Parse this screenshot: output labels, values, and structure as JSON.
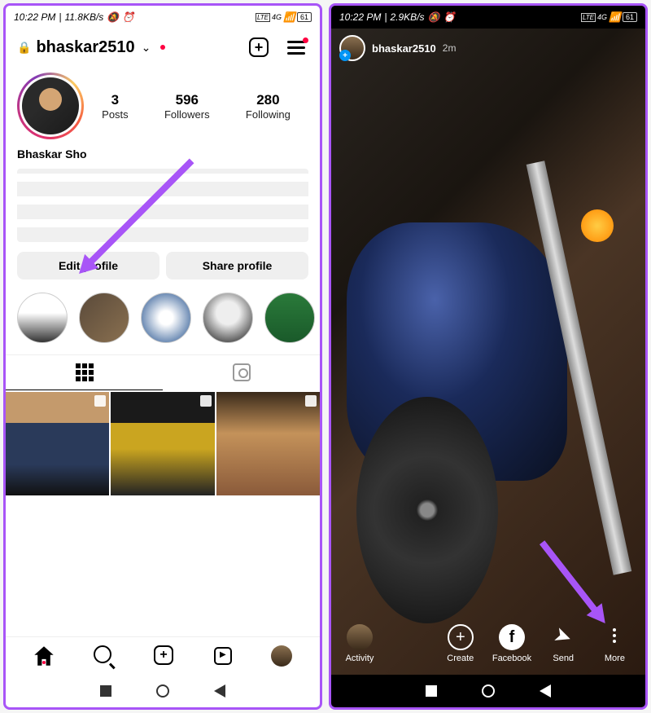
{
  "left": {
    "status": {
      "time": "10:22 PM",
      "speed": "11.8KB/s",
      "network": "4G",
      "battery": "61"
    },
    "header": {
      "username": "bhaskar2510"
    },
    "profile": {
      "stats": {
        "posts": "3",
        "posts_lbl": "Posts",
        "followers": "596",
        "followers_lbl": "Followers",
        "following": "280",
        "following_lbl": "Following"
      },
      "display_name": "Bhaskar Sho"
    },
    "buttons": {
      "edit": "Edit profile",
      "share": "Share profile"
    }
  },
  "right": {
    "status": {
      "time": "10:22 PM",
      "speed": "2.9KB/s",
      "network": "4G",
      "battery": "61"
    },
    "story": {
      "username": "bhaskar2510",
      "time": "2m"
    },
    "bottom": {
      "activity": "Activity",
      "create": "Create",
      "facebook": "Facebook",
      "send": "Send",
      "more": "More"
    }
  }
}
